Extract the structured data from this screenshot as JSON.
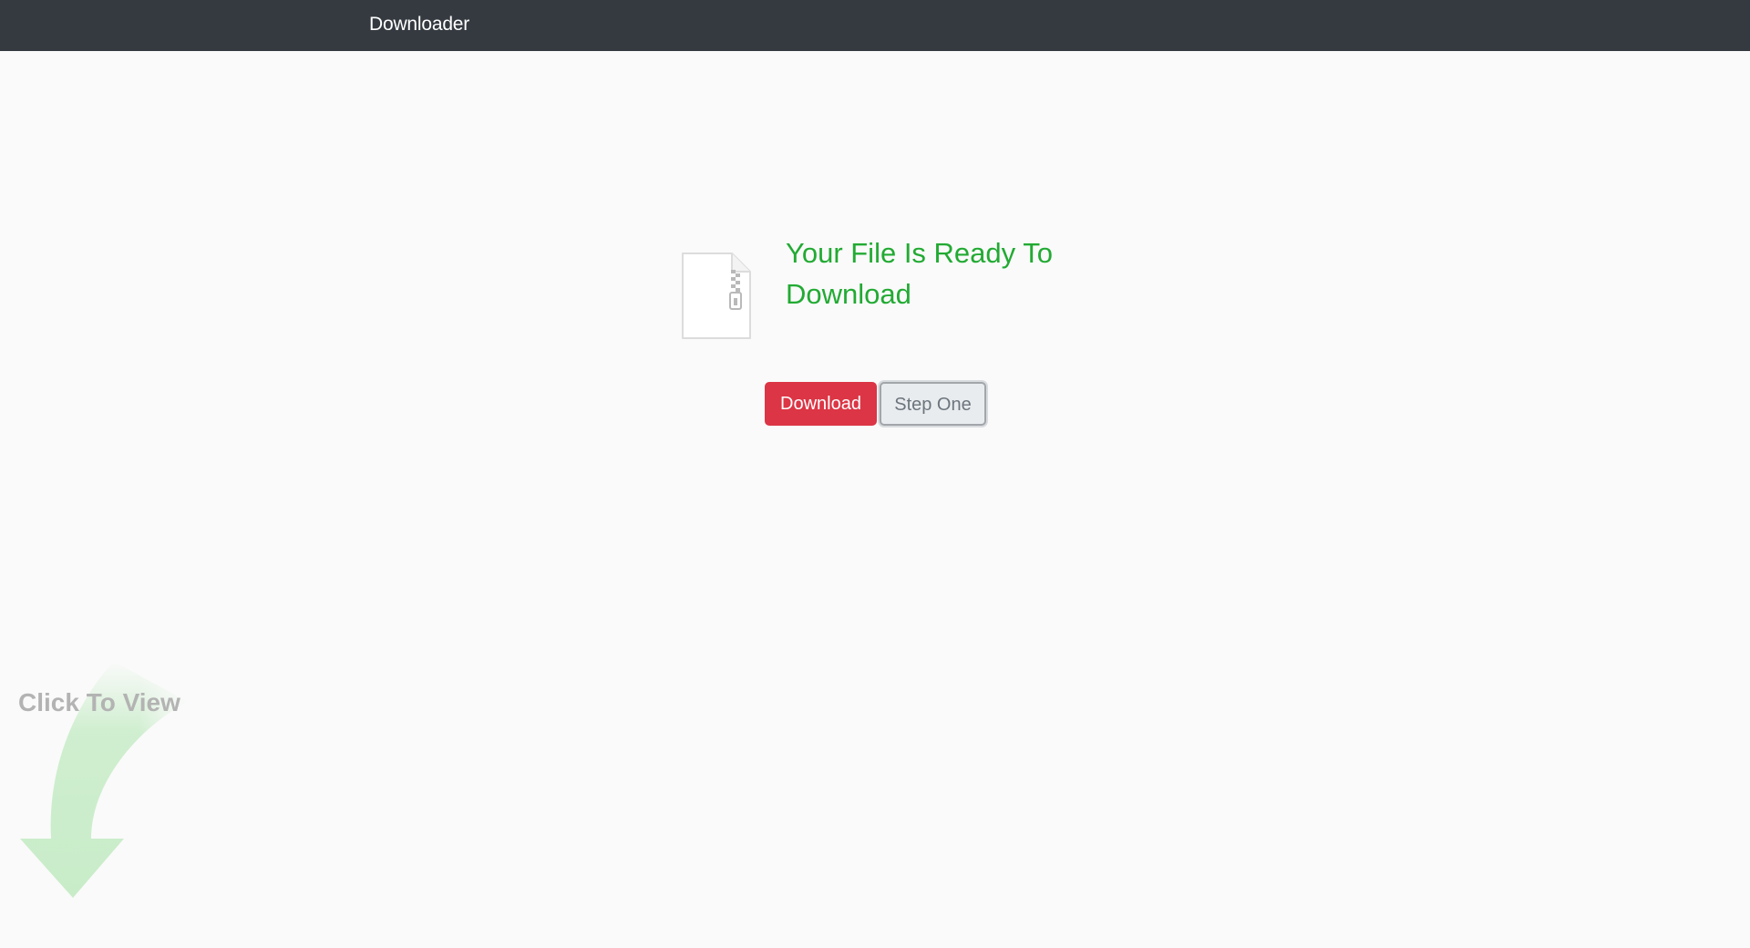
{
  "navbar": {
    "brand": "Downloader"
  },
  "main": {
    "file_icon": "zip-file-icon",
    "title": "Your File Is Ready To Download",
    "buttons": {
      "download_label": "Download",
      "step_one_label": "Step One"
    }
  },
  "promo": {
    "label": "Click To View",
    "arrow_icon": "curved-arrow-down-icon"
  },
  "colors": {
    "navbar_bg": "#343a40",
    "title_green": "#22aa33",
    "download_red": "#dc3545",
    "arrow_green": "#c8ecc8"
  }
}
